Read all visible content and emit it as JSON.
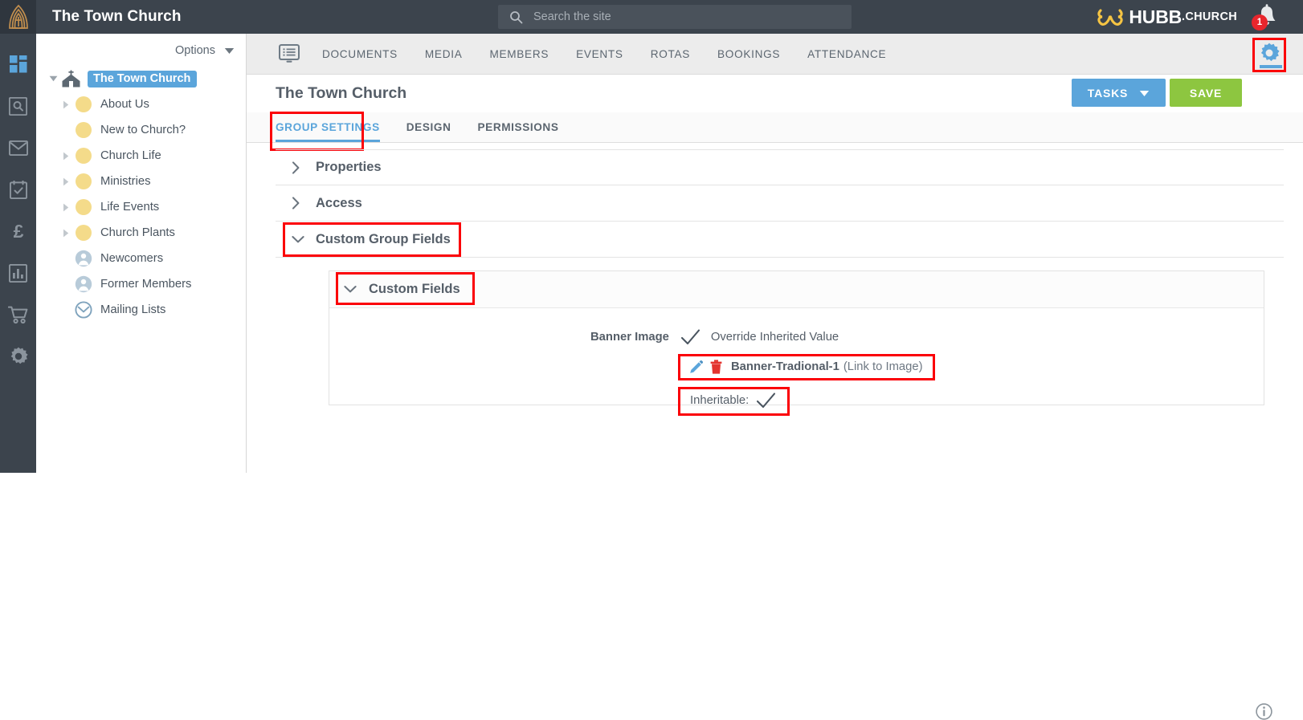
{
  "topbar": {
    "logo_icon": "church-arch-logo-icon",
    "site_title": "The Town Church",
    "search": {
      "icon": "search-icon",
      "placeholder": "Search the site",
      "value": ""
    },
    "brand": {
      "mark_icon": "hubb-butterfly-icon",
      "name": "HUBB",
      "suffix": ".CHURCH"
    },
    "notifications": {
      "icon": "bell-icon",
      "count": "1"
    }
  },
  "rail": {
    "items": [
      {
        "icon": "dashboard-icon",
        "name": "dashboard",
        "active": true
      },
      {
        "icon": "search-icon",
        "name": "search",
        "active": false
      },
      {
        "icon": "mail-icon",
        "name": "mail",
        "active": false
      },
      {
        "icon": "calendar-check-icon",
        "name": "tasks",
        "active": false
      },
      {
        "icon": "pound-sterling-icon",
        "name": "finance",
        "active": false
      },
      {
        "icon": "bar-chart-icon",
        "name": "reports",
        "active": false
      },
      {
        "icon": "shopping-cart-icon",
        "name": "shop",
        "active": false
      },
      {
        "icon": "gear-icon",
        "name": "settings",
        "active": false
      }
    ]
  },
  "sidebar": {
    "options_label": "Options",
    "options_caret_icon": "caret-down-icon",
    "tree": [
      {
        "label": "The Town Church",
        "icon": "church-home-icon",
        "twisty": "caret-down-icon",
        "selected": true,
        "indent": 0
      },
      {
        "label": "About Us",
        "icon": "folder-dot-icon",
        "twisty": "caret-right-icon",
        "selected": false,
        "indent": 1
      },
      {
        "label": "New to Church?",
        "icon": "folder-dot-icon",
        "twisty": "",
        "selected": false,
        "indent": 1
      },
      {
        "label": "Church Life",
        "icon": "folder-dot-icon",
        "twisty": "caret-right-icon",
        "selected": false,
        "indent": 1
      },
      {
        "label": "Ministries",
        "icon": "folder-dot-icon",
        "twisty": "caret-right-icon",
        "selected": false,
        "indent": 1
      },
      {
        "label": "Life Events",
        "icon": "folder-dot-icon",
        "twisty": "caret-right-icon",
        "selected": false,
        "indent": 1
      },
      {
        "label": "Church Plants",
        "icon": "folder-dot-icon",
        "twisty": "caret-right-icon",
        "selected": false,
        "indent": 1
      },
      {
        "label": "Newcomers",
        "icon": "person-circle-icon",
        "twisty": "",
        "selected": false,
        "indent": 1
      },
      {
        "label": "Former Members",
        "icon": "person-circle-icon",
        "twisty": "",
        "selected": false,
        "indent": 1
      },
      {
        "label": "Mailing Lists",
        "icon": "envelope-circle-icon",
        "twisty": "",
        "selected": false,
        "indent": 1
      }
    ]
  },
  "navbar": {
    "doc_icon": "document-list-icon",
    "items": [
      "DOCUMENTS",
      "MEDIA",
      "MEMBERS",
      "EVENTS",
      "ROTAS",
      "BOOKINGS",
      "ATTENDANCE"
    ],
    "gear": {
      "icon": "gear-icon",
      "highlighted": true,
      "active": true
    }
  },
  "page": {
    "title": "The Town Church",
    "tasks_button": {
      "label": "TASKS",
      "caret_icon": "caret-down-icon"
    },
    "save_button": {
      "label": "SAVE"
    },
    "tabs": [
      {
        "label": "GROUP SETTINGS",
        "active": true,
        "highlighted": true
      },
      {
        "label": "DESIGN",
        "active": false,
        "highlighted": false
      },
      {
        "label": "PERMISSIONS",
        "active": false,
        "highlighted": false
      }
    ],
    "sections": [
      {
        "label": "Properties",
        "chevron": "chevron-right-icon",
        "expanded": false,
        "highlighted": false
      },
      {
        "label": "Access",
        "chevron": "chevron-right-icon",
        "expanded": false,
        "highlighted": false
      },
      {
        "label": "Custom Group Fields",
        "chevron": "chevron-down-icon",
        "expanded": true,
        "highlighted": true
      }
    ],
    "custom_fields": {
      "panel_label": "Custom Fields",
      "panel_chevron": "chevron-down-icon",
      "panel_highlighted": true,
      "field": {
        "label": "Banner Image",
        "override_check_icon": "check-icon",
        "override_label": "Override Inherited Value",
        "edit_icon": "pencil-icon",
        "delete_icon": "trash-icon",
        "value_name": "Banner-Tradional-1",
        "value_kind": "(Link to Image)",
        "value_highlighted": true,
        "info_icon": "info-circle-icon",
        "inheritable_label": "Inheritable:",
        "inheritable_check_icon": "check-icon",
        "inheritable_highlighted": true
      }
    }
  },
  "colors": {
    "topbar_bg": "#3c444d",
    "accent_blue": "#5ba5db",
    "save_green": "#8dc640",
    "highlight_red": "#fb0007",
    "brand_yellow": "#f5c443",
    "folder_yellow": "#f4db8a",
    "badge_red": "#e8262d",
    "trash_red": "#e3342f"
  }
}
